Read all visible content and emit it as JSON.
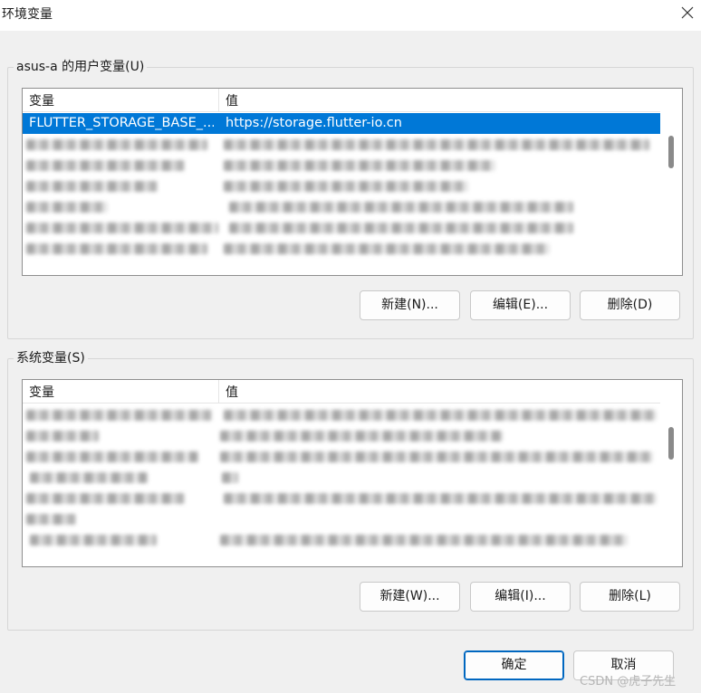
{
  "window": {
    "title": "环境变量",
    "close_icon": "close-icon"
  },
  "user_vars": {
    "group_label": "asus-a 的用户变量(U)",
    "columns": [
      "变量",
      "值"
    ],
    "rows": [
      {
        "name": "FLUTTER_STORAGE_BASE_...",
        "value": "https://storage.flutter-io.cn",
        "selected": true
      },
      {
        "name": "",
        "value": "",
        "blurred": true
      },
      {
        "name": "",
        "value": "",
        "blurred": true
      },
      {
        "name": "",
        "value": "",
        "blurred": true
      },
      {
        "name": "",
        "value": "",
        "blurred": true
      },
      {
        "name": "",
        "value": "",
        "blurred": true
      },
      {
        "name": "",
        "value": "",
        "blurred": true
      }
    ],
    "buttons": {
      "new": "新建(N)...",
      "edit": "编辑(E)...",
      "delete": "删除(D)"
    }
  },
  "system_vars": {
    "group_label": "系统变量(S)",
    "columns": [
      "变量",
      "值"
    ],
    "rows": [
      {
        "name": "",
        "value": "",
        "blurred": true
      },
      {
        "name": "",
        "value": "",
        "blurred": true
      },
      {
        "name": "",
        "value": "",
        "blurred": true
      },
      {
        "name": "",
        "value": "",
        "blurred": true
      },
      {
        "name": "",
        "value": "",
        "blurred": true
      },
      {
        "name": "",
        "value": "",
        "blurred": true
      },
      {
        "name": "",
        "value": "",
        "blurred": true
      }
    ],
    "buttons": {
      "new": "新建(W)...",
      "edit": "编辑(I)...",
      "delete": "删除(L)"
    }
  },
  "footer": {
    "ok": "确定",
    "cancel": "取消"
  },
  "watermark": "CSDN @虎子先生",
  "colors": {
    "selection": "#0078d7",
    "primary_border": "#0067c0"
  }
}
